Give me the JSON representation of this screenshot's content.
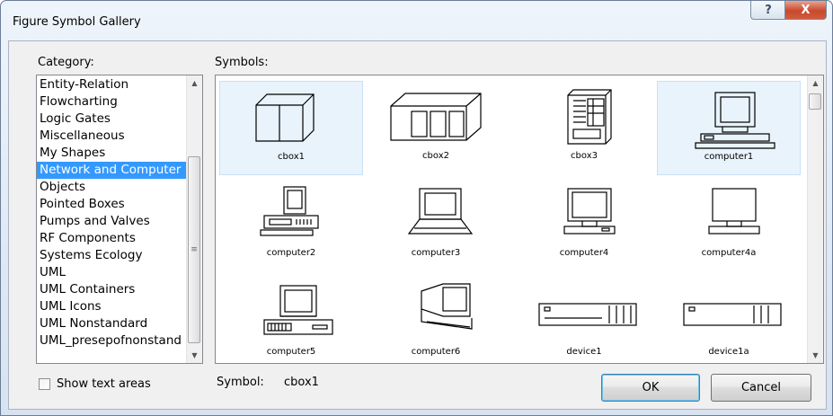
{
  "window": {
    "title": "Figure Symbol Gallery"
  },
  "titlebar": {
    "help_glyph": "?",
    "close_glyph": "X"
  },
  "category": {
    "label": "Category:",
    "items": [
      "Entity-Relation",
      "Flowcharting",
      "Logic Gates",
      "Miscellaneous",
      "My Shapes",
      "Network and Computer",
      "Objects",
      "Pointed Boxes",
      "Pumps and Valves",
      "RF Components",
      "Systems Ecology",
      "UML",
      "UML Containers",
      "UML Icons",
      "UML Nonstandard",
      "UML_presepofnonstand"
    ],
    "selected": "Network and Computer"
  },
  "symbols": {
    "label": "Symbols:",
    "items": [
      {
        "name": "cbox1",
        "icon": "cbox1-icon",
        "selected": true
      },
      {
        "name": "cbox2",
        "icon": "cbox2-icon"
      },
      {
        "name": "cbox3",
        "icon": "cbox3-icon"
      },
      {
        "name": "computer1",
        "icon": "computer1-icon",
        "selected": true
      },
      {
        "name": "computer2",
        "icon": "computer2-icon"
      },
      {
        "name": "computer3",
        "icon": "computer3-icon"
      },
      {
        "name": "computer4",
        "icon": "computer4-icon"
      },
      {
        "name": "computer4a",
        "icon": "computer4a-icon"
      },
      {
        "name": "computer5",
        "icon": "computer5-icon"
      },
      {
        "name": "computer6",
        "icon": "computer6-icon"
      },
      {
        "name": "device1",
        "icon": "device1-icon"
      },
      {
        "name": "device1a",
        "icon": "device1a-icon"
      }
    ]
  },
  "show_text_areas": {
    "label": "Show text areas",
    "checked": false
  },
  "symbol_readout": {
    "label": "Symbol:",
    "value": "cbox1"
  },
  "buttons": {
    "ok": "OK",
    "cancel": "Cancel"
  },
  "colors": {
    "selection": "#3399ff",
    "hover_tile": "#e8f3fc",
    "close_button": "#c74a2e"
  }
}
